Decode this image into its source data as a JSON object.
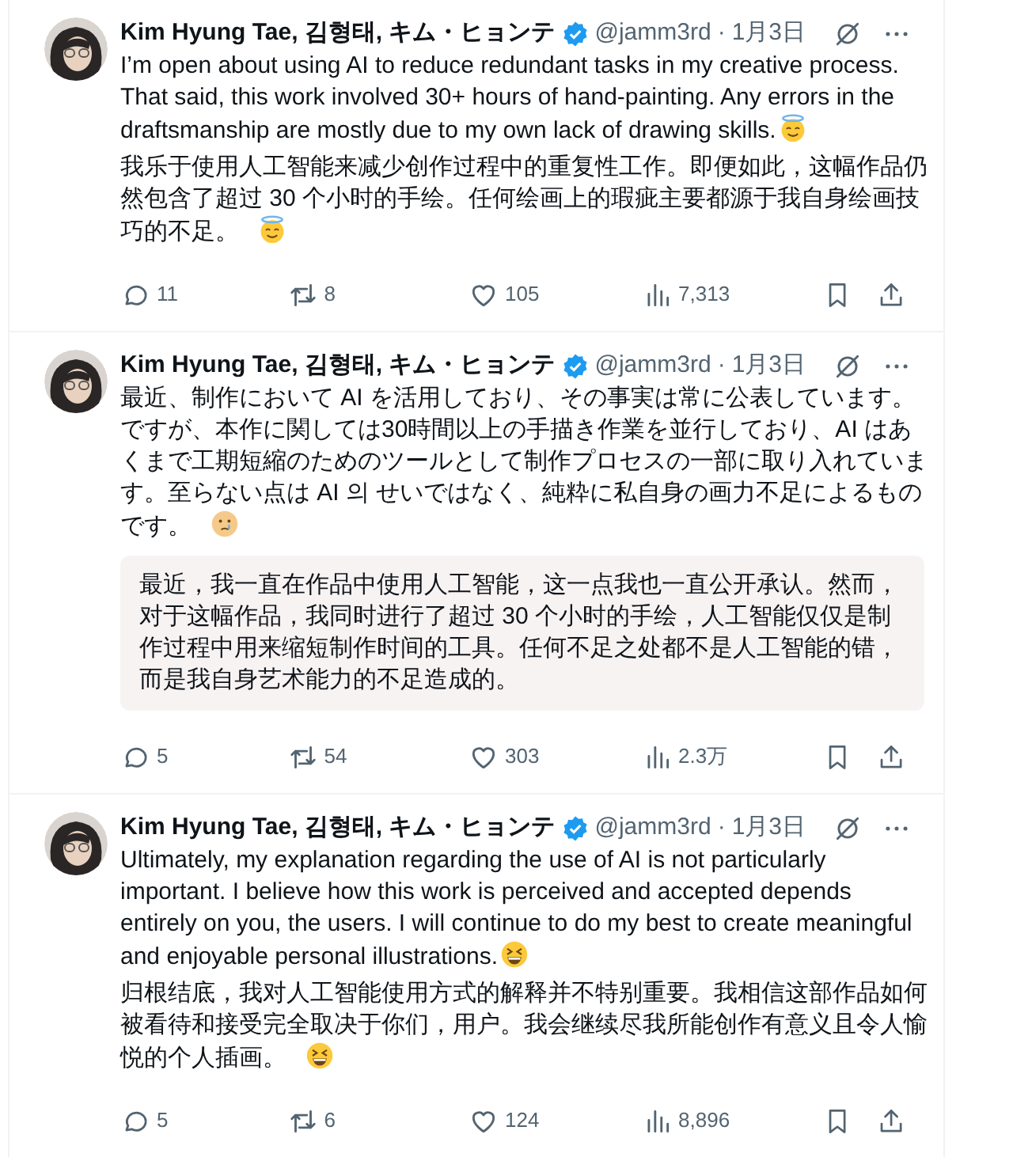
{
  "posts": [
    {
      "author": {
        "name": "Kim Hyung Tae, 김형태, キム・ヒョンテ",
        "verified": true,
        "handle": "@jamm3rd",
        "separator": "·",
        "date": "1月3日"
      },
      "paragraphs": [
        "I’m open about using AI to reduce redundant tasks in my creative process. That said, this work involved 30+ hours of hand-painting. Any errors in the draftsmanship are mostly due to my own lack of drawing skills.",
        "我乐于使用人工智能来减少创作过程中的重复性工作。即便如此，这幅作品仍然包含了超过 30 个小时的手绘。任何绘画上的瑕疵主要都源于我自身绘画技巧的不足。"
      ],
      "stats": {
        "replies": "11",
        "reposts": "8",
        "likes": "105",
        "views": "7,313"
      }
    },
    {
      "author": {
        "name": "Kim Hyung Tae, 김형태, キム・ヒョンテ",
        "verified": true,
        "handle": "@jamm3rd",
        "separator": "·",
        "date": "1月3日"
      },
      "paragraphs": [
        "最近、制作において AI を活用しており、その事実は常に公表しています。ですが、本作に関しては30時間以上の手描き作業を並行しており、AI はあくまで工期短縮のためのツールとして制作プロセスの一部に取り入れています。至らない点は AI 의 せいではなく、純粋に私自身の画力不足によるものです。"
      ],
      "translation": "最近，我一直在作品中使用人工智能，这一点我也一直公开承认。然而，对于这幅作品，我同时进行了超过 30 个小时的手绘，人工智能仅仅是制作过程中用来缩短制作时间的工具。任何不足之处都不是人工智能的错，而是我自身艺术能力的不足造成的。",
      "stats": {
        "replies": "5",
        "reposts": "54",
        "likes": "303",
        "views": "2.3万"
      }
    },
    {
      "author": {
        "name": "Kim Hyung Tae, 김형태, キム・ヒョンテ",
        "verified": true,
        "handle": "@jamm3rd",
        "separator": "·",
        "date": "1月3日"
      },
      "paragraphs": [
        "Ultimately, my explanation regarding the use of AI is not particularly important. I believe how this work is perceived and accepted depends entirely on you, the users. I will continue to do my best to create meaningful and enjoyable personal illustrations.",
        "归根结底，我对人工智能使用方式的解释并不特别重要。我相信这部作品如何被看待和接受完全取决于你们，用户。我会继续尽我所能创作有意义且令人愉悦的个人插画。"
      ],
      "stats": {
        "replies": "5",
        "reposts": "6",
        "likes": "124",
        "views": "8,896"
      }
    }
  ]
}
